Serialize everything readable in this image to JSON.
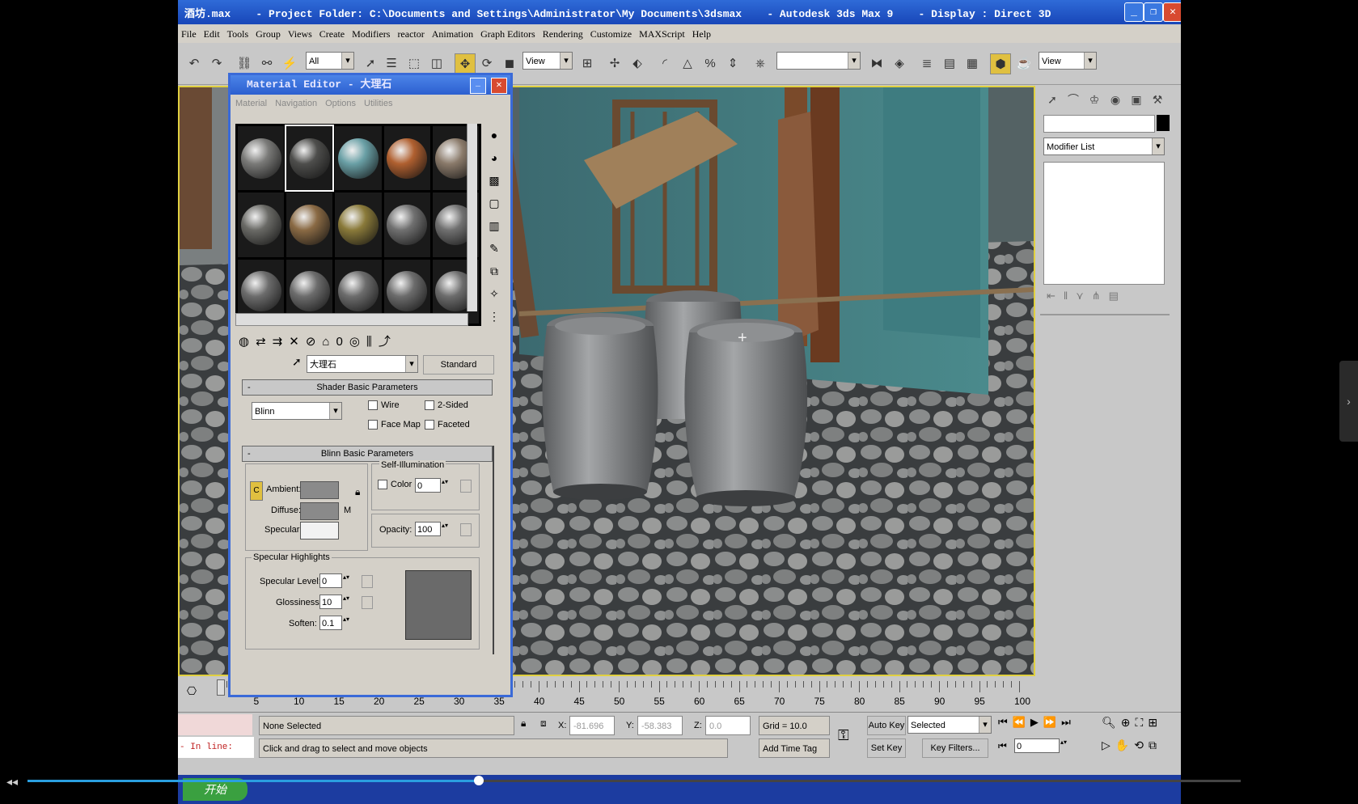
{
  "window": {
    "title": "酒坊.max    - Project Folder: C:\\Documents and Settings\\Administrator\\My Documents\\3dsmax    - Autodesk 3ds Max 9    - Display : Direct 3D"
  },
  "menu": [
    "File",
    "Edit",
    "Tools",
    "Group",
    "Views",
    "Create",
    "Modifiers",
    "reactor",
    "Animation",
    "Graph Editors",
    "Rendering",
    "Customize",
    "MAXScript",
    "Help"
  ],
  "toolbar": {
    "selection_filter": "All",
    "ref_coord": "View",
    "named_selection": "",
    "render_view": "View"
  },
  "command_panel": {
    "modifier_list": "Modifier List"
  },
  "material_editor": {
    "title": "Material Editor - 大理石",
    "menu": [
      "Material",
      "Navigation",
      "Options",
      "Utilities"
    ],
    "material_name": "大理石",
    "material_type": "Standard",
    "shader_rollout": "Shader Basic Parameters",
    "shader": "Blinn",
    "wire": "Wire",
    "two_sided": "2-Sided",
    "face_map": "Face Map",
    "faceted": "Faceted",
    "blinn_rollout": "Blinn Basic Parameters",
    "self_illum": "Self-Illumination",
    "color_label": "Color",
    "color_value": "0",
    "ambient": "Ambient:",
    "diffuse": "Diffuse:",
    "specular": "Specular:",
    "opacity_label": "Opacity:",
    "opacity_value": "100",
    "lock_c": "C",
    "m_label": "M",
    "spec_highlights": "Specular Highlights",
    "spec_level_label": "Specular Level:",
    "spec_level": "0",
    "glossiness_label": "Glossiness:",
    "glossiness": "10",
    "soften_label": "Soften:",
    "soften": "0.1",
    "slot_colors": [
      "#7a7a78",
      "#4e4e4c",
      "#6aa0a6",
      "#b06030",
      "#8a7a6a",
      "#6a6a66",
      "#8a6a44",
      "#8a7a3a",
      "#707070",
      "#707070",
      "#6c6c6c",
      "#6c6c6c",
      "#6c6c6c",
      "#6c6c6c",
      "#6c6c6c"
    ]
  },
  "timeline": {
    "ticks": [
      "5",
      "10",
      "15",
      "20",
      "25",
      "30",
      "35",
      "40",
      "45",
      "50",
      "55",
      "60",
      "65",
      "70",
      "75",
      "80",
      "85",
      "90",
      "95",
      "100"
    ]
  },
  "status": {
    "selected": "None Selected",
    "prompt": "Click and drag to select and move objects",
    "x_label": "X:",
    "x": "-81.696",
    "y_label": "Y:",
    "y": "-58.383",
    "z_label": "Z:",
    "z": "0.0",
    "grid": "Grid = 10.0",
    "add_time_tag": "Add Time Tag",
    "auto_key": "Auto Key",
    "set_key": "Set Key",
    "key_mode": "Selected",
    "key_filters": "Key Filters...",
    "frame": "0",
    "inline": "In line:"
  },
  "taskbar": {
    "start": "开始"
  }
}
